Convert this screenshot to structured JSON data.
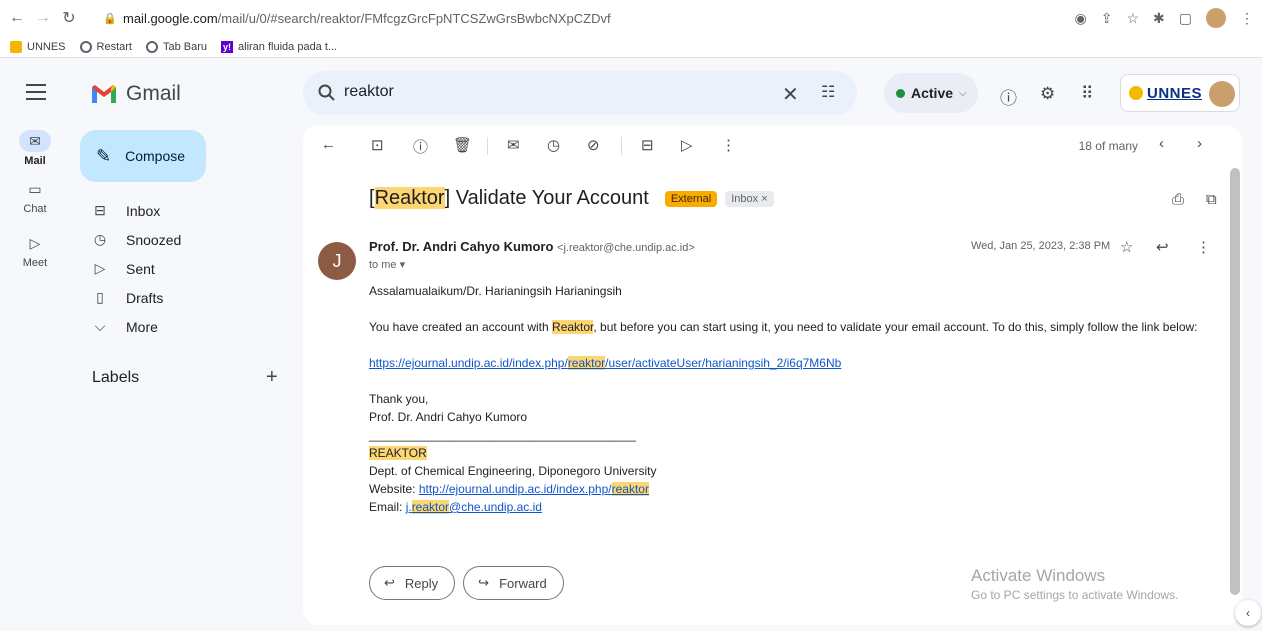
{
  "browser": {
    "url_domain": "mail.google.com",
    "url_path": "/mail/u/0/#search/reaktor/FMfcgzGrcFpNTCSZwGrsBwbcNXpCZDvf",
    "bookmarks": [
      {
        "label": "UNNES",
        "icon": "folder-icon"
      },
      {
        "label": "Restart",
        "icon": "globe-icon"
      },
      {
        "label": "Tab Baru",
        "icon": "globe-icon"
      },
      {
        "label": "aliran fluida pada t...",
        "icon": "yahoo-icon"
      }
    ]
  },
  "header": {
    "app_name": "Gmail",
    "search_value": "reaktor",
    "status_label": "Active",
    "org_logo": "UNNES"
  },
  "rail": {
    "items": [
      {
        "label": "Mail",
        "icon": "mail-icon"
      },
      {
        "label": "Chat",
        "icon": "chat-icon"
      },
      {
        "label": "Meet",
        "icon": "video-icon"
      }
    ]
  },
  "sidebar": {
    "compose_label": "Compose",
    "folders": [
      {
        "label": "Inbox",
        "icon": "inbox-icon"
      },
      {
        "label": "Snoozed",
        "icon": "clock-icon"
      },
      {
        "label": "Sent",
        "icon": "send-icon"
      },
      {
        "label": "Drafts",
        "icon": "draft-icon"
      },
      {
        "label": "More",
        "icon": "chevron-down-icon"
      }
    ],
    "labels_title": "Labels"
  },
  "toolbar": {
    "pager": "18 of many"
  },
  "message": {
    "subject_highlight": "Reaktor",
    "subject_rest": "Validate Your Account",
    "badge_external": "External",
    "badge_inbox": "Inbox",
    "sender_initial": "J",
    "sender_name": "Prof. Dr. Andri Cahyo Kumoro",
    "sender_email": "<j.reaktor@che.undip.ac.id>",
    "to": "to me",
    "date": "Wed, Jan 25, 2023, 2:38 PM",
    "greeting": "Assalamualaikum/Dr. Harianingsih Harianingsih",
    "para_pre": "You have created an account with ",
    "para_hl": "Reaktor",
    "para_post": ", but before you can start using it, you need to validate your email account. To do this, simply follow the link below:",
    "link_pre": "https://ejournal.undip.ac.id/index.php/",
    "link_hl": "reaktor",
    "link_post": "/user/activateUser/harianingsih_2/i6q7M6Nb",
    "thanks": "Thank you,",
    "signature_name": "Prof. Dr. Andri Cahyo Kumoro",
    "sig_rule": "________________________________________",
    "sig_org": "REAKTOR",
    "sig_dept": "Dept. of Chemical Engineering, Diponegoro University",
    "sig_web_label": "Website: ",
    "sig_web_pre": "http://ejournal.undip.ac.id/index.php/",
    "sig_web_hl": "reaktor",
    "sig_email_label": "Email: ",
    "sig_email_pre": "j.",
    "sig_email_hl": "reaktor",
    "sig_email_post": "@che.undip.ac.id"
  },
  "actions": {
    "reply": "Reply",
    "forward": "Forward"
  },
  "watermark": {
    "line1": "Activate Windows",
    "line2": "Go to PC settings to activate Windows."
  }
}
